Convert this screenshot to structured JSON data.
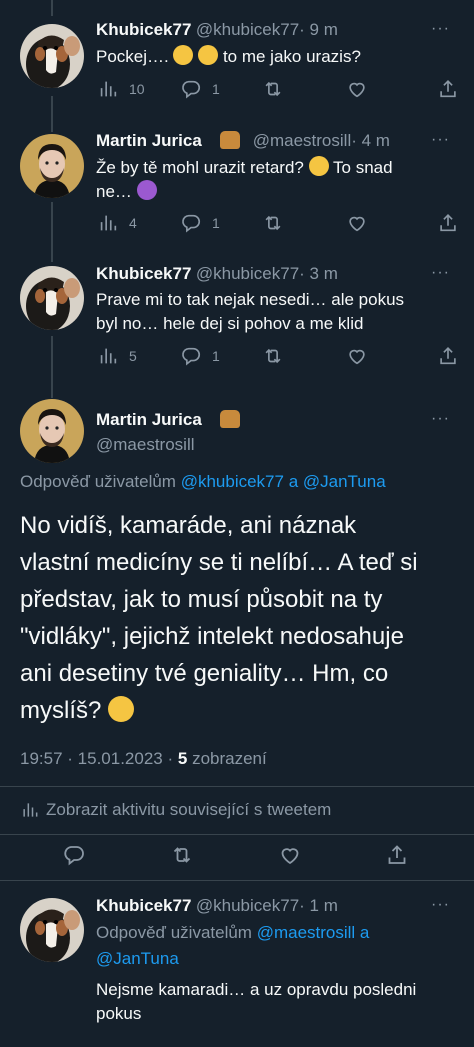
{
  "colors": {
    "background": "#15202b",
    "text": "#f7f9f9",
    "muted": "#8b98a5",
    "link": "#1d9bf0",
    "border": "#38444d"
  },
  "tweets": [
    {
      "name": "Khubicek77",
      "handle": "@khubicek77",
      "time": "· 9 m",
      "text": "Pockej…. ",
      "text2": " to me jako urazis?",
      "emoji": [
        "face-with-tears-of-joy",
        "face-with-tears-of-joy"
      ],
      "stats": {
        "views": "10",
        "replies": "1",
        "retweets": "",
        "likes": ""
      }
    },
    {
      "name": "Martin Jurica",
      "handle": "@maestrosill",
      "time": "· 4 m",
      "badge": "dog-emoji",
      "line1": "Že by tě mohl urazit retard? ",
      "line1b": " To snad",
      "line2": "ne… ",
      "emoji": [
        "thinking-face",
        "smiling-face-with-horns"
      ],
      "stats": {
        "views": "4",
        "replies": "1",
        "retweets": "",
        "likes": ""
      }
    },
    {
      "name": "Khubicek77",
      "handle": "@khubicek77",
      "time": "· 3 m",
      "line1": "Prave mi to tak nejak nesedi… ale pokus",
      "line2": "byl no… hele dej si pohov a me klid",
      "stats": {
        "views": "5",
        "replies": "1",
        "retweets": "",
        "likes": ""
      }
    }
  ],
  "main_tweet": {
    "name": "Martin Jurica",
    "handle": "@maestrosill",
    "badge": "dog-emoji",
    "reply_prefix": "Odpověď uživatelům ",
    "reply_user1": "@khubicek77",
    "reply_join": " a ",
    "reply_user2": "@JanTuna",
    "lines": [
      "No vidíš, kamaráde, ani náznak",
      "vlastní medicíny se ti nelíbí… A teď si",
      "představ, jak to musí působit na ty",
      "\"vidláky\", jejichž intelekt nedosahuje",
      "ani desetiny tvé geniality… Hm, co",
      "myslíš? "
    ],
    "end_emoji": "thinking-face",
    "time": "19:57",
    "date": "15.01.2023",
    "views_count": "5",
    "views_label": "zobrazení",
    "activity_label": "Zobrazit aktivitu související s tweetem"
  },
  "last_reply": {
    "name": "Khubicek77",
    "handle": "@khubicek77",
    "time": "· 1 m",
    "reply_prefix": "Odpověď uživatelům ",
    "reply_user1": "@maestrosill",
    "reply_join": " a",
    "reply_user2": "@JanTuna",
    "line1": "Nejsme kamaradi… a uz opravdu posledni",
    "line2": "pokus"
  },
  "more_label": "···"
}
